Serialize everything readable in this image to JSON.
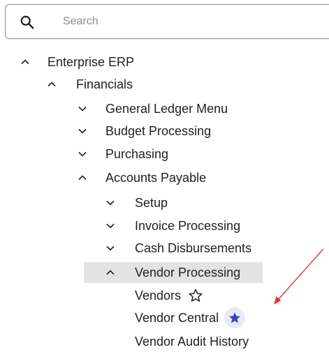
{
  "search": {
    "placeholder": "Search",
    "value": ""
  },
  "tree": [
    {
      "label": "Enterprise ERP",
      "expanded": true
    },
    {
      "label": "Financials",
      "expanded": true
    },
    {
      "label": "General Ledger Menu",
      "expanded": false
    },
    {
      "label": "Budget Processing",
      "expanded": false
    },
    {
      "label": "Purchasing",
      "expanded": false
    },
    {
      "label": "Accounts Payable",
      "expanded": true
    },
    {
      "label": "Setup",
      "expanded": false
    },
    {
      "label": "Invoice Processing",
      "expanded": false
    },
    {
      "label": "Cash Disbursements",
      "expanded": false
    },
    {
      "label": "Vendor Processing",
      "expanded": true,
      "selected": true
    },
    {
      "label": "Vendors",
      "favorite": false
    },
    {
      "label": "Vendor Central",
      "favorite": true
    },
    {
      "label": "Vendor Audit History",
      "favorite": false
    }
  ],
  "colors": {
    "favorite_star": "#3949ab",
    "favorite_badge_bg": "#e8eaf6",
    "selected_row_bg": "#e3e3e3",
    "annotation_arrow": "#e53935"
  }
}
